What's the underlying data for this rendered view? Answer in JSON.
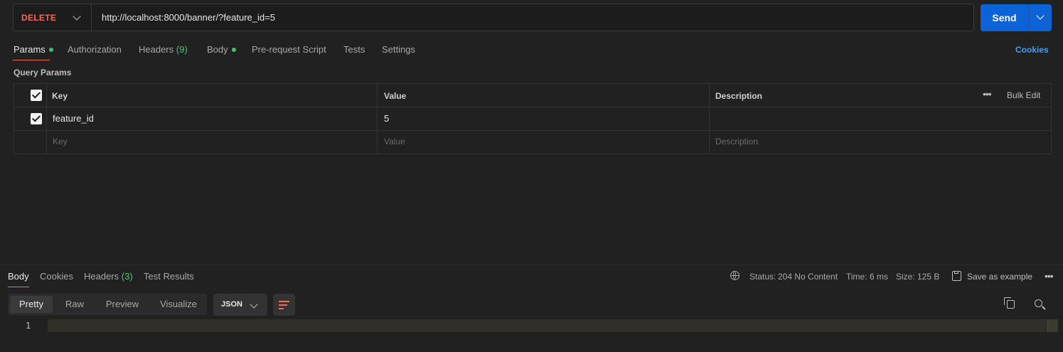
{
  "request": {
    "method": "DELETE",
    "url": "http://localhost:8000/banner/?feature_id=5",
    "send_label": "Send"
  },
  "request_tabs": {
    "params": "Params",
    "authorization": "Authorization",
    "headers": "Headers",
    "headers_count": "(9)",
    "body": "Body",
    "pre_request_script": "Pre-request Script",
    "tests": "Tests",
    "settings": "Settings",
    "cookies": "Cookies"
  },
  "query_params": {
    "title": "Query Params",
    "columns": {
      "key": "Key",
      "value": "Value",
      "description": "Description",
      "bulk_edit": "Bulk Edit"
    },
    "rows": [
      {
        "checked": true,
        "key": "feature_id",
        "value": "5",
        "description": ""
      }
    ],
    "placeholder": {
      "key": "Key",
      "value": "Value",
      "description": "Description"
    }
  },
  "response": {
    "tabs": {
      "body": "Body",
      "cookies": "Cookies",
      "headers": "Headers",
      "headers_count": "(3)",
      "test_results": "Test Results"
    },
    "status_label": "Status:",
    "status_value": "204 No Content",
    "time_label": "Time:",
    "time_value": "6 ms",
    "size_label": "Size:",
    "size_value": "125 B",
    "save_example": "Save as example",
    "view_modes": [
      "Pretty",
      "Raw",
      "Preview",
      "Visualize"
    ],
    "format": "JSON",
    "line_number": "1"
  },
  "colors": {
    "method": "#f26b5b",
    "send": "#0c63d8",
    "accent_link": "#4a9df5",
    "status_ok": "#53c27b",
    "active_underline": "#f26b5b"
  },
  "icons": [
    "chevron-down-icon",
    "globe-icon",
    "save-icon",
    "more-icon",
    "wrap-lines-icon",
    "copy-icon",
    "search-icon",
    "checkbox-checked-icon"
  ]
}
